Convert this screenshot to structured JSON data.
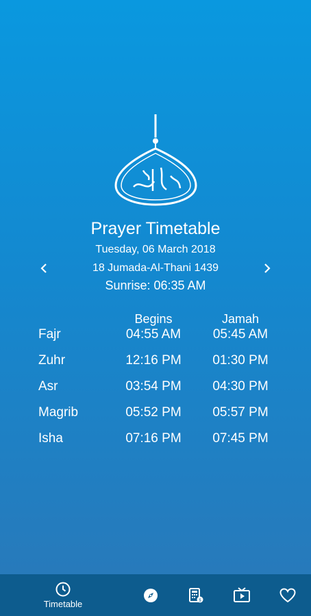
{
  "header": {
    "title": "Prayer Timetable",
    "gregorian_date": "Tuesday, 06 March 2018",
    "hijri_date": "18 Jumada-Al-Thani 1439",
    "sunrise": "Sunrise: 06:35 AM"
  },
  "table": {
    "col_begins": "Begins",
    "col_jamah": "Jamah",
    "rows": [
      {
        "name": "Fajr",
        "begins": "04:55 AM",
        "jamah": "05:45 AM"
      },
      {
        "name": "Zuhr",
        "begins": "12:16 PM",
        "jamah": "01:30 PM"
      },
      {
        "name": "Asr",
        "begins": "03:54 PM",
        "jamah": "04:30 PM"
      },
      {
        "name": "Magrib",
        "begins": "05:52 PM",
        "jamah": "05:57 PM"
      },
      {
        "name": "Isha",
        "begins": "07:16 PM",
        "jamah": "07:45 PM"
      }
    ]
  },
  "bottom_nav": {
    "items": [
      {
        "label": "Timetable",
        "icon": "clock-icon"
      },
      {
        "label": "",
        "icon": "compass-icon"
      },
      {
        "label": "",
        "icon": "calculator-icon"
      },
      {
        "label": "",
        "icon": "tv-icon"
      },
      {
        "label": "",
        "icon": "heart-icon"
      }
    ]
  },
  "colors": {
    "bg_top": "#0a98df",
    "bg_bottom": "#2a78b8",
    "nav_bg": "#0d5c8e",
    "text": "#ffffff"
  }
}
